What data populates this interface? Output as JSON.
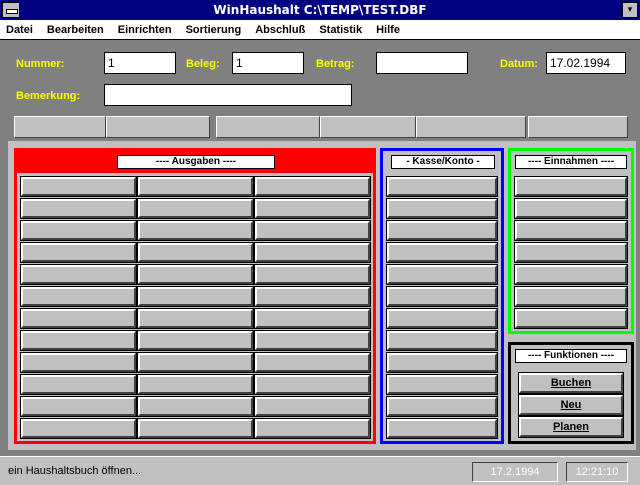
{
  "window": {
    "title": "WinHaushalt  C:\\TEMP\\TEST.DBF"
  },
  "menu": [
    "Datei",
    "Bearbeiten",
    "Einrichten",
    "Sortierung",
    "Abschluß",
    "Statistik",
    "Hilfe"
  ],
  "form": {
    "nummer_label": "Nummer:",
    "nummer_value": "1",
    "beleg_label": "Beleg:",
    "beleg_value": "1",
    "betrag_label": "Betrag:",
    "betrag_value": "",
    "datum_label": "Datum:",
    "datum_value": "17.02.1994",
    "bemerkung_label": "Bemerkung:",
    "bemerkung_value": ""
  },
  "panels": {
    "ausgaben_title": "---- Ausgaben ----",
    "kasse_title": "- Kasse/Konto -",
    "einnahmen_title": "---- Einnahmen ----",
    "funktionen_title": "---- Funktionen ----"
  },
  "functions": [
    "Buchen",
    "Neu",
    "Planen"
  ],
  "status": {
    "message": "ein Haushaltsbuch öffnen...",
    "date": "17.2.1994",
    "time": "12:21:10"
  },
  "colors": {
    "ausgaben": "#ff0000",
    "kasse": "#0000ff",
    "einnahmen": "#00ff00",
    "funktionen": "#000000",
    "labels": "#ffff00"
  }
}
